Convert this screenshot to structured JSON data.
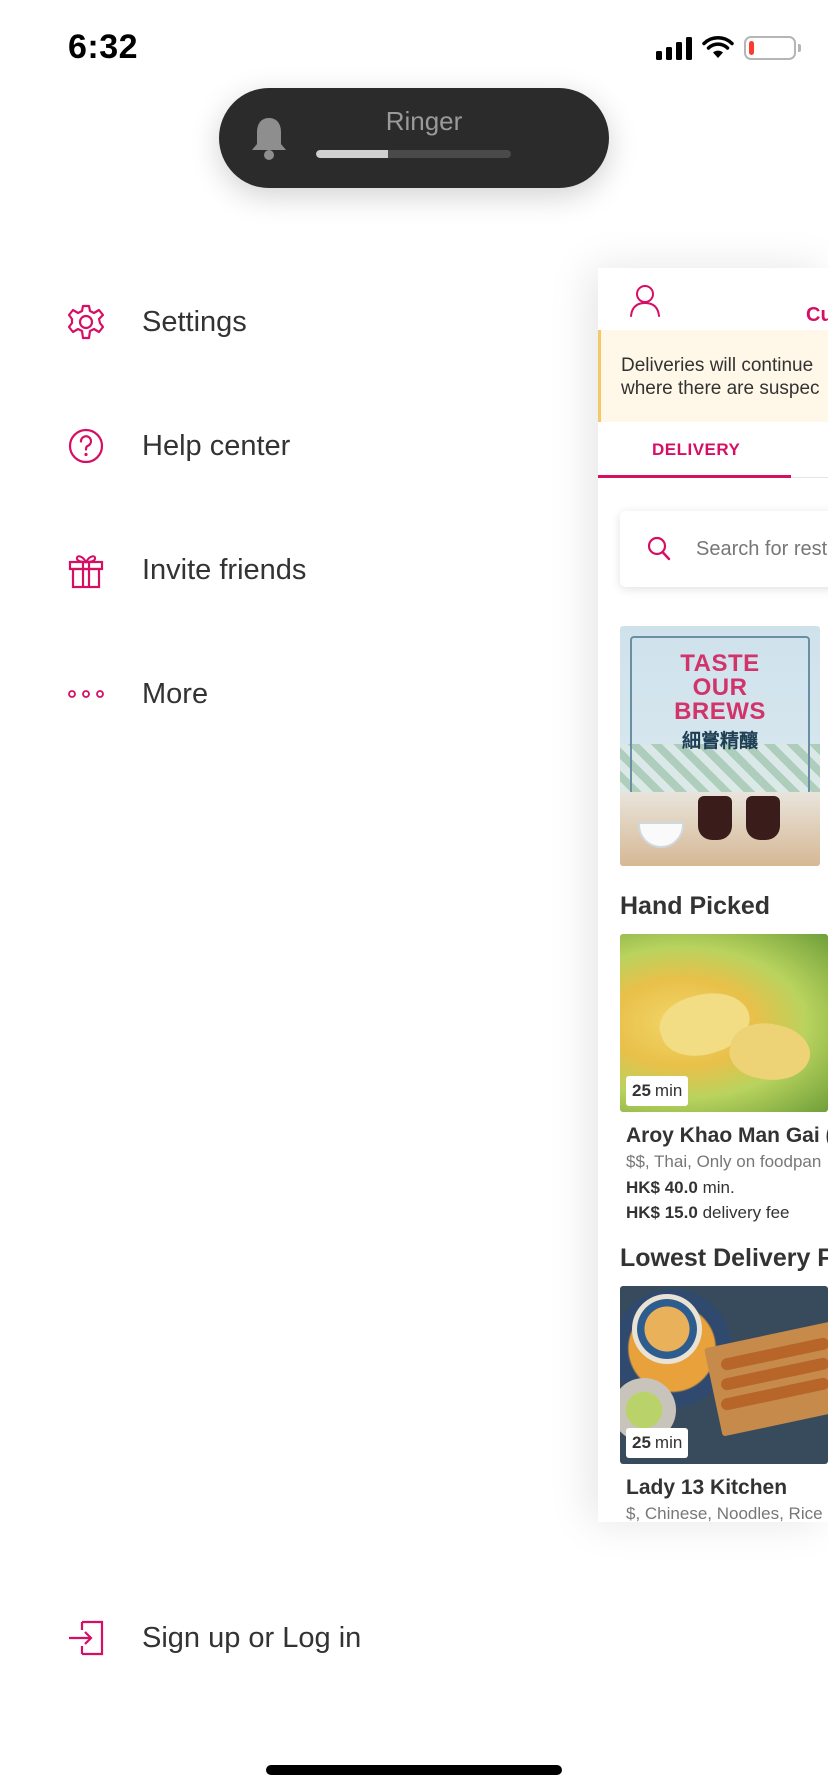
{
  "status_bar": {
    "time": "6:32",
    "battery_level": 0.12,
    "battery_color": "#ff3b30"
  },
  "ringer_hud": {
    "label": "Ringer",
    "volume_level": 0.37,
    "icon": "bell-icon"
  },
  "drawer_menu": {
    "items": [
      {
        "label": "Settings",
        "icon": "gear-icon"
      },
      {
        "label": "Help center",
        "icon": "question-circle-icon"
      },
      {
        "label": "Invite friends",
        "icon": "gift-icon"
      },
      {
        "label": "More",
        "icon": "ellipsis-icon"
      }
    ],
    "login_label": "Sign up or Log in",
    "login_icon": "login-icon",
    "accent_color": "#d70f64"
  },
  "app": {
    "top_tab_partial": "Cu",
    "notice_line1": "Deliveries will continue",
    "notice_line2": "where there are suspec",
    "delivery_tab": "DELIVERY",
    "search_placeholder": "Search for rest",
    "promo": {
      "title_line1": "TASTE",
      "title_line2": "OUR",
      "title_line3": "BREWS",
      "subtitle": "細嘗精釀"
    },
    "sections": [
      {
        "title": "Hand Picked",
        "restaurant": {
          "time_value": "25",
          "time_unit": "min",
          "name": "Aroy Khao Man Gai (N",
          "meta": "$$, Thai, Only on foodpan",
          "min_amount": "HK$ 40.0",
          "min_suffix": "min.",
          "fee_amount": "HK$ 15.0",
          "fee_suffix": "delivery fee"
        }
      },
      {
        "title": "Lowest Delivery F",
        "restaurant": {
          "time_value": "25",
          "time_unit": "min",
          "name": "Lady 13 Kitchen",
          "meta": "$, Chinese, Noodles, Rice"
        }
      }
    ]
  }
}
